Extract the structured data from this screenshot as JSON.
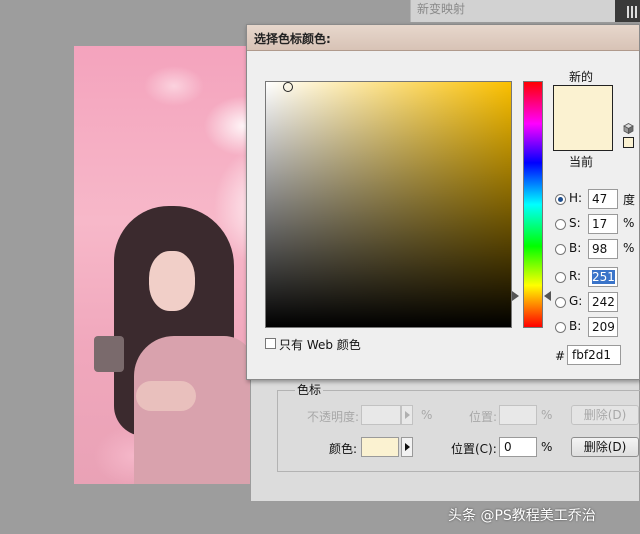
{
  "background": {
    "panel_title": "新变映射"
  },
  "picker": {
    "title": "选择色标颜色:",
    "new_label": "新的",
    "current_label": "当前",
    "new_color": "#fbf2d1",
    "current_color": "#fbf2d1",
    "hue_field_color": "#fbc000",
    "params": {
      "H": {
        "label": "H:",
        "value": "47",
        "unit": "度",
        "selected": true
      },
      "S": {
        "label": "S:",
        "value": "17",
        "unit": "%"
      },
      "Bv": {
        "label": "B:",
        "value": "98",
        "unit": "%"
      },
      "R": {
        "label": "R:",
        "value": "251"
      },
      "G": {
        "label": "G:",
        "value": "242"
      },
      "Bb": {
        "label": "B:",
        "value": "209"
      }
    },
    "hex_label": "#",
    "hex_value": "fbf2d1",
    "web_only_label": "只有 Web 颜色"
  },
  "color_stop": {
    "group_title": "色标",
    "opacity_label": "不透明度:",
    "opacity_unit": "%",
    "opacity_location_label": "位置:",
    "opacity_location_unit": "%",
    "delete_label_1": "删除(D)",
    "color_label": "颜色:",
    "color_swatch": "#fbf2d1",
    "location_label": "位置(C):",
    "location_value": "0",
    "location_unit": "%",
    "delete_label_2": "删除(D)"
  },
  "watermark": "头条 @PS教程美工乔治"
}
